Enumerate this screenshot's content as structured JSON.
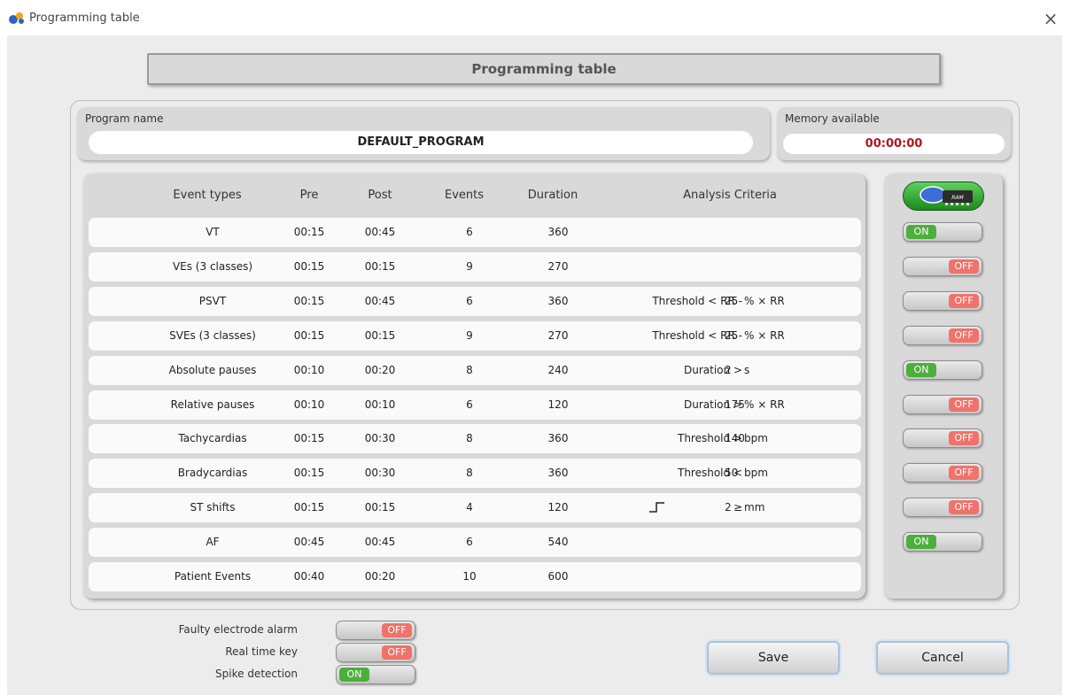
{
  "window": {
    "title": "Programming table",
    "close_glyph": "×"
  },
  "header": {
    "title": "Programming table"
  },
  "program": {
    "label": "Program name",
    "value": "DEFAULT_PROGRAM"
  },
  "memory": {
    "label": "Memory available",
    "value": "00:00:00",
    "value_color": "#b3121c"
  },
  "table": {
    "columns": [
      "Event types",
      "Pre",
      "Post",
      "Events",
      "Duration",
      "Analysis Criteria"
    ],
    "rows": [
      {
        "type": "VT",
        "pre": "00:15",
        "post": "00:45",
        "events": "6",
        "duration": "360",
        "criteria": "",
        "value": "",
        "unit": "",
        "enabled": "ON"
      },
      {
        "type": "VEs (3 classes)",
        "pre": "00:15",
        "post": "00:15",
        "events": "9",
        "duration": "270",
        "criteria": "",
        "value": "",
        "unit": "",
        "enabled": "OFF"
      },
      {
        "type": "PSVT",
        "pre": "00:15",
        "post": "00:45",
        "events": "6",
        "duration": "360",
        "criteria": "Threshold < RR -",
        "value": "25",
        "unit": "% × RR",
        "enabled": "OFF"
      },
      {
        "type": "SVEs (3 classes)",
        "pre": "00:15",
        "post": "00:15",
        "events": "9",
        "duration": "270",
        "criteria": "Threshold < RR -",
        "value": "25",
        "unit": "% × RR",
        "enabled": "OFF"
      },
      {
        "type": "Absolute pauses",
        "pre": "00:10",
        "post": "00:20",
        "events": "8",
        "duration": "240",
        "criteria": "Duration >",
        "value": "2",
        "unit": "s",
        "enabled": "ON"
      },
      {
        "type": "Relative pauses",
        "pre": "00:10",
        "post": "00:10",
        "events": "6",
        "duration": "120",
        "criteria": "Duration >",
        "value": "175",
        "unit": "% × RR",
        "enabled": "OFF"
      },
      {
        "type": "Tachycardias",
        "pre": "00:15",
        "post": "00:30",
        "events": "8",
        "duration": "360",
        "criteria": "Threshold >",
        "value": "140",
        "unit": "bpm",
        "enabled": "OFF"
      },
      {
        "type": "Bradycardias",
        "pre": "00:15",
        "post": "00:30",
        "events": "8",
        "duration": "360",
        "criteria": "Threshold <",
        "value": "50",
        "unit": "bpm",
        "enabled": "OFF"
      },
      {
        "type": "ST shifts",
        "pre": "00:15",
        "post": "00:15",
        "events": "4",
        "duration": "120",
        "criteria": "≥",
        "value": "2",
        "unit": "mm",
        "enabled": "OFF"
      },
      {
        "type": "AF",
        "pre": "00:45",
        "post": "00:45",
        "events": "6",
        "duration": "540",
        "criteria": "",
        "value": "",
        "unit": "",
        "enabled": "ON"
      },
      {
        "type": "Patient Events",
        "pre": "00:40",
        "post": "00:20",
        "events": "10",
        "duration": "600",
        "criteria": "",
        "value": "",
        "unit": "",
        "enabled": ""
      }
    ]
  },
  "ram_button": {
    "label": "RAM",
    "icon": "ram-chip-icon"
  },
  "options": [
    {
      "label": "Faulty electrode alarm",
      "state": "OFF"
    },
    {
      "label": "Real time key",
      "state": "OFF"
    },
    {
      "label": "Spike detection",
      "state": "ON"
    }
  ],
  "buttons": {
    "save": "Save",
    "cancel": "Cancel"
  },
  "colors": {
    "on": "#4caf3c",
    "off": "#f0736b",
    "accent": "#a9c2dd"
  }
}
